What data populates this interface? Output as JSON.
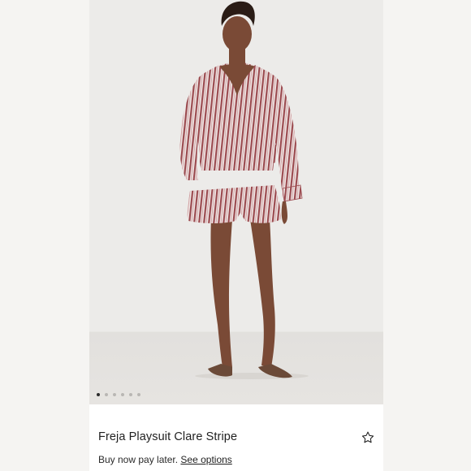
{
  "product": {
    "title": "Freja Playsuit Clare Stripe",
    "image_alt": "Model wearing striped long-sleeve playsuit with sandals",
    "image_count": 6,
    "active_image_index": 0
  },
  "payment": {
    "text": "Buy now pay later.",
    "link": "See options"
  },
  "icons": {
    "favorite": "star-icon"
  },
  "colors": {
    "stripe_red": "#9b4a4f",
    "background": "#ecebe9"
  }
}
